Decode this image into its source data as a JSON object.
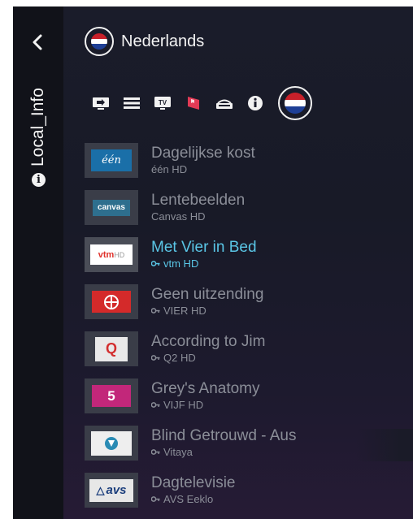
{
  "sidebar": {
    "title": "Local_Info"
  },
  "header": {
    "title": "Nederlands"
  },
  "colors": {
    "accent": "#5ac6e6",
    "muted": "#8b8e98",
    "flag_red": "#c8202a",
    "flag_blue": "#1e3f96"
  },
  "toolbar": {
    "icons": [
      "input-icon",
      "menu-icon",
      "tv-icon",
      "bookmark-icon",
      "channel-icon",
      "info-icon",
      "country-flag-icon"
    ]
  },
  "logos": {
    "een": "één",
    "canvas": "canvas",
    "vtm": "vtm",
    "vtm_hd": "HD",
    "q2": "Q",
    "vijf": "5",
    "avs": "avs"
  },
  "channels": [
    {
      "title": "Dagelijkse kost",
      "channel": "één HD",
      "locked": false,
      "selected": false
    },
    {
      "title": "Lentebeelden",
      "channel": "Canvas HD",
      "locked": false,
      "selected": false
    },
    {
      "title": "Met Vier in Bed",
      "channel": "vtm HD",
      "locked": true,
      "selected": true
    },
    {
      "title": "Geen uitzending",
      "channel": "VIER HD",
      "locked": true,
      "selected": false
    },
    {
      "title": "According to Jim",
      "channel": "Q2 HD",
      "locked": true,
      "selected": false
    },
    {
      "title": "Grey's Anatomy",
      "channel": "VIJF HD",
      "locked": true,
      "selected": false
    },
    {
      "title": "Blind Getrouwd - Aus",
      "channel": "Vitaya",
      "locked": true,
      "selected": false
    },
    {
      "title": "Dagtelevisie",
      "channel": "AVS Eeklo",
      "locked": true,
      "selected": false
    }
  ]
}
